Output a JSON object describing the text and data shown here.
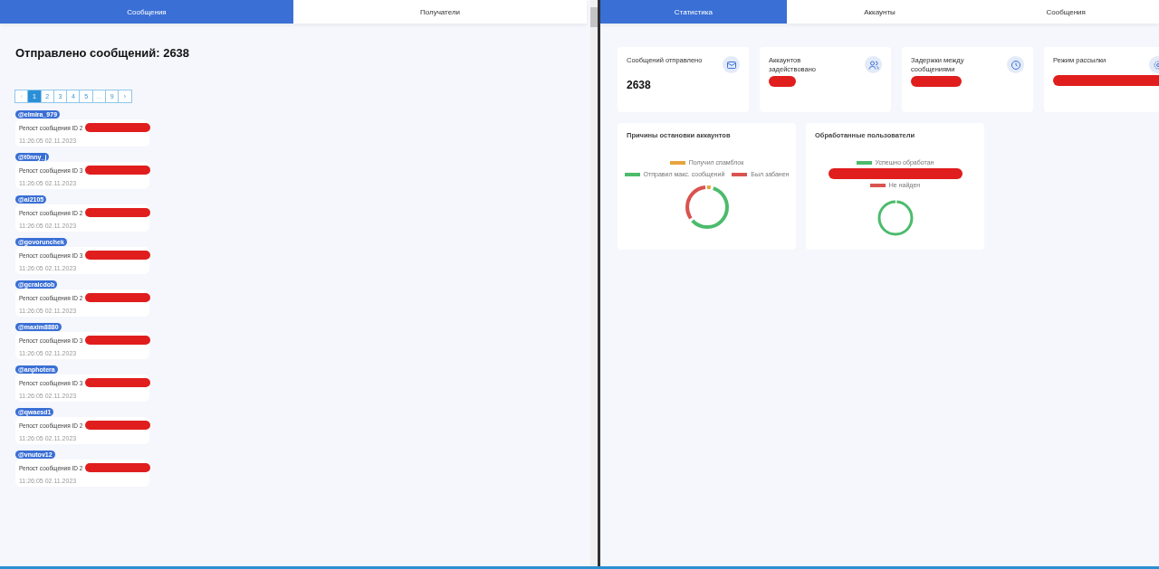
{
  "left_tabs": [
    {
      "label": "Сообщения",
      "selected": true
    },
    {
      "label": "Получатели",
      "selected": false
    }
  ],
  "sent_title": "Отправлено сообщений: 2638",
  "pagination": [
    {
      "label": "‹",
      "selected": false,
      "disabled": true
    },
    {
      "label": "1",
      "selected": true,
      "disabled": false
    },
    {
      "label": "2",
      "selected": false,
      "disabled": false
    },
    {
      "label": "3",
      "selected": false,
      "disabled": false
    },
    {
      "label": "4",
      "selected": false,
      "disabled": false
    },
    {
      "label": "5",
      "selected": false,
      "disabled": false
    },
    {
      "label": "...",
      "selected": false,
      "disabled": true
    },
    {
      "label": "9",
      "selected": false,
      "disabled": false
    },
    {
      "label": "›",
      "selected": false,
      "disabled": false
    }
  ],
  "messages": [
    {
      "user": "@elmira_979",
      "text": "Репост сообщения ID 2",
      "time": "11:26:05 02.11.2023"
    },
    {
      "user": "@t0nny_j",
      "text": "Репост сообщения ID 3",
      "time": "11:26:05 02.11.2023"
    },
    {
      "user": "@ai2105",
      "text": "Репост сообщения ID 2",
      "time": "11:26:05 02.11.2023"
    },
    {
      "user": "@govorunchek",
      "text": "Репост сообщения ID 3",
      "time": "11:26:05 02.11.2023"
    },
    {
      "user": "@gcraicdob",
      "text": "Репост сообщения ID 2",
      "time": "11:26:05 02.11.2023"
    },
    {
      "user": "@maxim8880",
      "text": "Репост сообщения ID 3",
      "time": "11:26:05 02.11.2023"
    },
    {
      "user": "@anphotera",
      "text": "Репост сообщения ID 3",
      "time": "11:26:05 02.11.2023"
    },
    {
      "user": "@qwaesd1",
      "text": "Репост сообщения ID 2",
      "time": "11:26:05 02.11.2023"
    },
    {
      "user": "@vnutov12",
      "text": "Репост сообщения ID 2",
      "time": "11:26:05 02.11.2023"
    }
  ],
  "right_tabs": [
    {
      "label": "Статистика",
      "selected": true
    },
    {
      "label": "Аккаунты",
      "selected": false
    },
    {
      "label": "Сообщения",
      "selected": false
    }
  ],
  "stat_cards": [
    {
      "title": "Сообщений отправлено",
      "value": "2638",
      "kind": "mail"
    },
    {
      "title": "Аккаунтов задействовано",
      "kind": "users"
    },
    {
      "title": "Задержки между сообщениями",
      "kind": "clock"
    },
    {
      "title": "Режим рассылки",
      "kind": "gear"
    }
  ],
  "charts": [
    {
      "title": "Причины остановки аккаунтов",
      "kind": "stops",
      "legend": [
        {
          "label": "Получил спамблок",
          "color": "#e8a33d"
        },
        {
          "label": "Отправил макс. сообщений",
          "color": "#4cbb6c"
        },
        {
          "label": "Был забанен",
          "color": "#d9534f"
        }
      ]
    },
    {
      "title": "Обработанные пользователи",
      "kind": "users",
      "legend": [
        {
          "label": "Успешно обработан",
          "color": "#4cbb6c"
        },
        {
          "label": "Не найден",
          "color": "#d9534f"
        }
      ]
    }
  ]
}
